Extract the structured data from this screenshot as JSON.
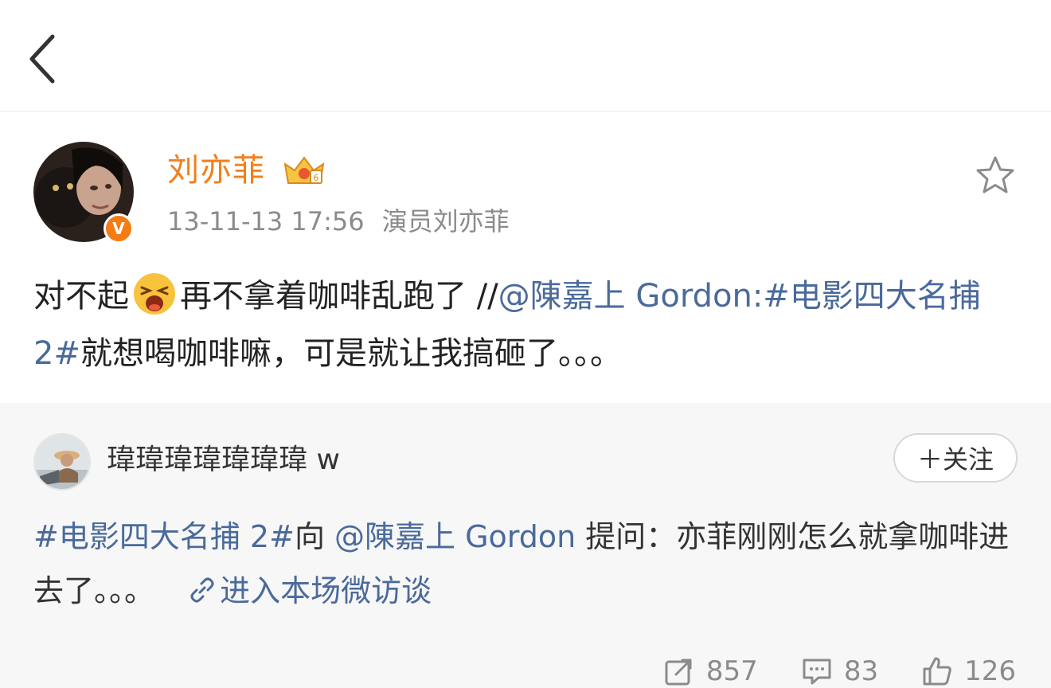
{
  "post": {
    "author": "刘亦菲",
    "timestamp": "13-11-13 17:56",
    "source": "演员刘亦菲",
    "verified_badge": "V",
    "text": {
      "part1": "对不起",
      "part2": "再不拿着咖啡乱跑了 //",
      "mention": "@陳嘉上 Gordon",
      "colon": ":",
      "hashtag": "#电影四大名捕 2#",
      "part3": "就想喝咖啡嘛，可是就让我搞砸了。。。"
    }
  },
  "retweet": {
    "author": "瑋瑋瑋瑋瑋瑋瑋 w",
    "follow_label": "＋关注",
    "text": {
      "hashtag": "#电影四大名捕 2#",
      "pre": "向 ",
      "mention": "@陳嘉上 Gordon",
      "body": " 提问：亦菲刚刚怎么就拿咖啡进去了。。。",
      "link_label": "进入本场微访谈"
    },
    "stats": {
      "reposts": "857",
      "comments": "83",
      "likes": "126"
    }
  },
  "colors": {
    "author_orange": "#f27f1b",
    "link_blue": "#4a6a9b",
    "meta_gray": "#8b8b8b",
    "badge_orange": "#f57c12"
  },
  "icons": {
    "back": "chevron-left-icon",
    "favorite": "star-outline-icon",
    "crown": "crown-icon",
    "emoji": "crying-face-icon",
    "link": "link-icon",
    "repost": "repost-icon",
    "comment": "comment-icon",
    "like": "thumbs-up-icon"
  }
}
